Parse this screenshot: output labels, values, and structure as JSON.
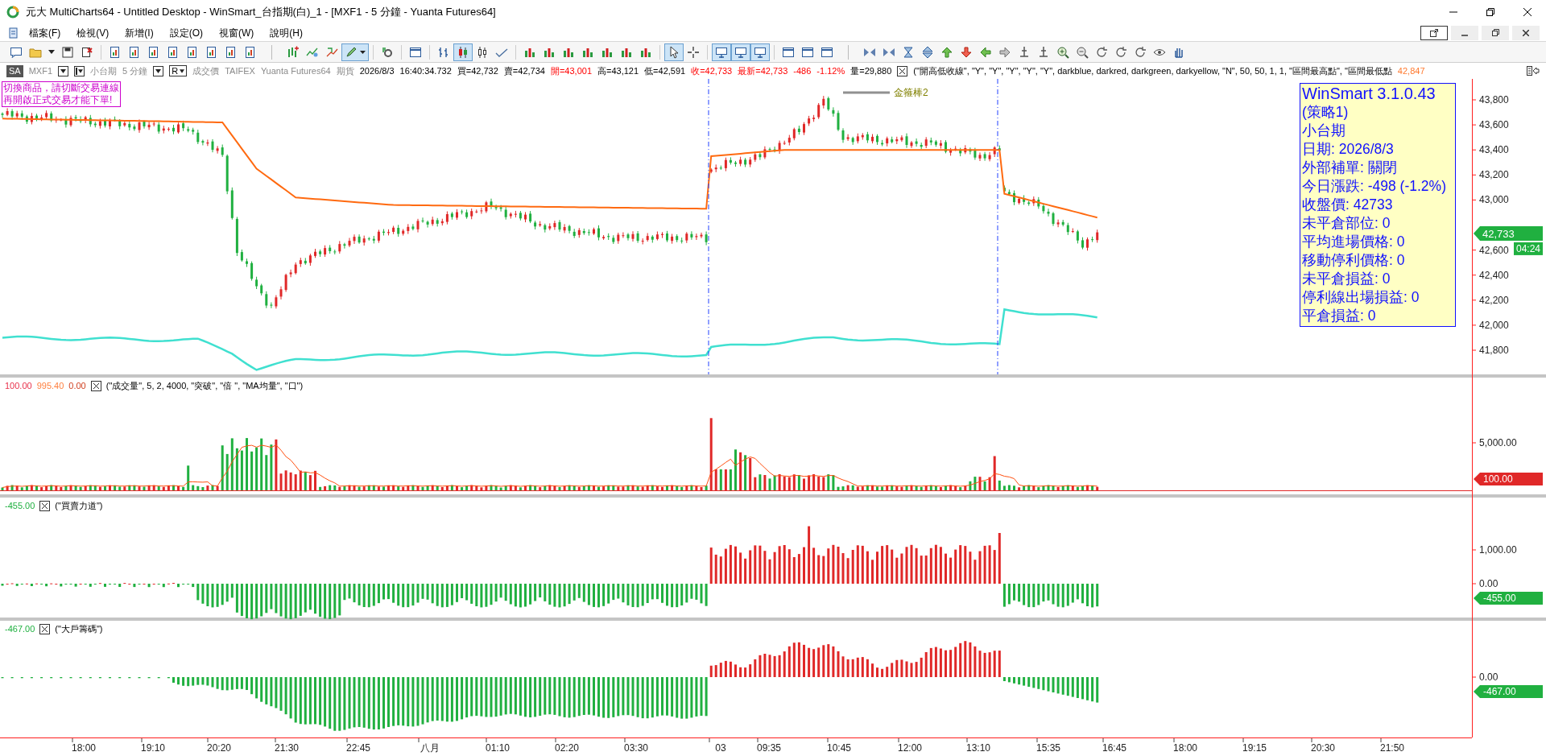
{
  "window": {
    "title": "元大 MultiCharts64 - Untitled Desktop - WinSmart_台指期(白)_1 - [MXF1 - 5 分鐘 - Yuanta Futures64]"
  },
  "menu": [
    "檔案(F)",
    "檢視(V)",
    "新增(I)",
    "設定(O)",
    "視窗(W)",
    "說明(H)"
  ],
  "toolbar": [
    {
      "pressed": false
    },
    {
      "pressed": false
    },
    {
      "pressed": false
    },
    {
      "pressed": false
    },
    {
      "pressed": false
    },
    {
      "pressed": false
    },
    {
      "pressed": false
    },
    {
      "pressed": false
    },
    {
      "pressed": false
    },
    {
      "pressed": false
    },
    {
      "pressed": false
    },
    {
      "pressed": false
    },
    {
      "pressed": false
    },
    {
      "pressed": false
    },
    {
      "pressed": false
    },
    {
      "pressed": false
    },
    {
      "pressed": true
    },
    {
      "pressed": false
    },
    {
      "pressed": false
    },
    {
      "pressed": false
    },
    {
      "pressed": true
    },
    {
      "pressed": false
    },
    {
      "pressed": false
    },
    {
      "pressed": false
    },
    {
      "pressed": false
    },
    {
      "pressed": false
    },
    {
      "pressed": false
    },
    {
      "pressed": false
    },
    {
      "pressed": false
    },
    {
      "pressed": false
    },
    {
      "pressed": true
    },
    {
      "pressed": false
    },
    {
      "pressed": true
    },
    {
      "pressed": true
    },
    {
      "pressed": true
    },
    {
      "pressed": false
    },
    {
      "pressed": false
    },
    {
      "pressed": false
    },
    {
      "pressed": false
    },
    {
      "pressed": false
    },
    {
      "pressed": false
    },
    {
      "pressed": false
    },
    {
      "pressed": false
    },
    {
      "pressed": false
    },
    {
      "pressed": false
    },
    {
      "pressed": false
    },
    {
      "pressed": false
    },
    {
      "pressed": false
    },
    {
      "pressed": false
    },
    {
      "pressed": false
    },
    {
      "pressed": false
    },
    {
      "pressed": false
    },
    {
      "pressed": false
    },
    {
      "pressed": false
    },
    {
      "pressed": false
    }
  ],
  "symbol_bar": {
    "mode": "SA",
    "symbol": "MXF1",
    "name": "小台期",
    "interval": "5 分鐘",
    "data_type": "R",
    "field": "成交價",
    "exchange": "TAIFEX",
    "source": "Yuanta Futures64",
    "category": "期貨",
    "date": "2026/8/3",
    "time": "16:40:34.732",
    "quotes": [
      {
        "text": "買=42,732",
        "color": "#000000"
      },
      {
        "text": "賣=42,734",
        "color": "#000000"
      },
      {
        "text": "開=43,001",
        "color": "#ff0000"
      },
      {
        "text": "高=43,121",
        "color": "#000000"
      },
      {
        "text": "低=42,591",
        "color": "#000000"
      },
      {
        "text": "收=42,733",
        "color": "#ff0000"
      },
      {
        "text": "最新=42,733",
        "color": "#ff0000"
      },
      {
        "text": "-486",
        "color": "#ff0000"
      },
      {
        "text": "-1.12%",
        "color": "#ff0000"
      },
      {
        "text": "量=29,880",
        "color": "#000000"
      }
    ],
    "study": "(\"開高低收線\", \"Y\", \"Y\", \"Y\", \"Y\", \"Y\", darkblue, darkred, darkgreen, darkyellow, \"N\", 50, 50, 1, 1, \"區間最高點\", \"區間最低點",
    "study_value": "42,847"
  },
  "main_chart": {
    "notice": [
      "切換商品，請切斷交易連線",
      "再開啟正式交易才能下單!"
    ],
    "drawing_label": "金箍棒2",
    "info_box": [
      "WinSmart 3.1.0.43",
      "(策略1)",
      "小台期",
      "日期: 2026/8/3",
      "外部補單: 關閉",
      "今日漲跌: -498 (-1.2%)",
      "收盤價: 42733",
      "未平倉部位: 0",
      "平均進場價格: 0",
      "移動停利價格: 0",
      "未平倉損益: 0",
      "停利線出場損益: 0",
      "平倉損益: 0"
    ],
    "price_ticks": [
      "43,800",
      "43,600",
      "43,400",
      "43,200",
      "43,000",
      "42,600",
      "42,400",
      "42,200",
      "42,000",
      "41,800"
    ],
    "last_price": "42,733",
    "countdown": "04:24"
  },
  "panels": [
    {
      "kind": "volume",
      "values": [
        {
          "text": "100.00",
          "color": "#e8304a"
        },
        {
          "text": "995.40",
          "color": "#ff8040"
        },
        {
          "text": "0.00",
          "color": "#d04020"
        }
      ],
      "params": "(\"成交量\", 5, 2, 4000, \"突破\", \"倍 \", \"MA均量\", \"口\")",
      "ticks": [
        "5,000.00"
      ],
      "tag": "100.00"
    },
    {
      "kind": "buy_sell",
      "values": [
        {
          "text": "-455.00",
          "color": "#20b040"
        }
      ],
      "params": "(\"買賣力道\")",
      "ticks": [
        "1,000.00",
        "0.00"
      ],
      "tag": "-455.00"
    },
    {
      "kind": "big_player",
      "values": [
        {
          "text": "-467.00",
          "color": "#20b040"
        }
      ],
      "params": "(\"大戶籌碼\")",
      "ticks": [
        "0.00"
      ],
      "tag": "-467.00"
    }
  ],
  "time_axis": [
    "18:00",
    "19:10",
    "20:20",
    "21:30",
    "22:45",
    "八月",
    "01:10",
    "02:20",
    "03:30",
    "03",
    "09:35",
    "10:45",
    "12:00",
    "13:10",
    "15:35",
    "16:45",
    "18:00",
    "19:15",
    "20:30",
    "21:50"
  ]
}
